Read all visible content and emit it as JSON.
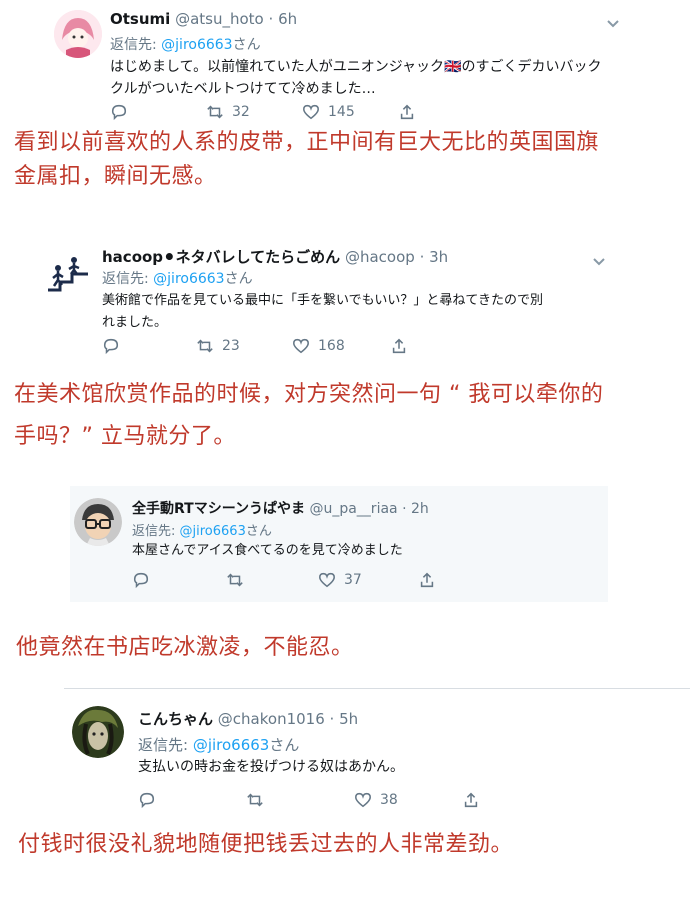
{
  "colors": {
    "caption": "#c0392b",
    "mention": "#1da1f2",
    "meta": "#657786",
    "name": "#14171a",
    "card_bg": "#f5f8fa"
  },
  "tweets": [
    {
      "name": "Otsumi",
      "handle": "@atsu_hoto",
      "dot": "·",
      "time": "6h",
      "reply_prefix": "返信先: ",
      "reply_to": "@jiro6663",
      "reply_suffix": "さん",
      "text_line1": "はじめまして。以前憧れていた人がユニオンジャック",
      "flag": "🇬🇧",
      "text_line1b": "のすごくデカいバック",
      "text_line2": "クルがついたベルトつけてて冷めました…",
      "retweets": "32",
      "likes": "145"
    },
    {
      "name": "hacoop",
      "name_icon": "⚫",
      "name_suffix": "ネタバレしてたらごめん",
      "handle": "@hacoop",
      "dot": "·",
      "time": "3h",
      "reply_prefix": "返信先: ",
      "reply_to": "@jiro6663",
      "reply_suffix": "さん",
      "text_line1": "美術館で作品を見ている最中に「手を繋いでもいい？」と尋ねてきたので別",
      "text_line2": "れました。",
      "retweets": "23",
      "likes": "168"
    },
    {
      "name": "全手動RTマシーンうぱやま",
      "handle": "@u_pa__riaa",
      "dot": "·",
      "time": "2h",
      "reply_prefix": "返信先: ",
      "reply_to": "@jiro6663",
      "reply_suffix": "さん",
      "text_line1": "本屋さんでアイス食べてるのを見て冷めました",
      "likes": "37"
    },
    {
      "name": "こんちゃん",
      "handle": "@chakon1016",
      "dot": "·",
      "time": "5h",
      "reply_prefix": "返信先: ",
      "reply_to": "@jiro6663",
      "reply_suffix": "さん",
      "text_line1": "支払いの時お金を投げつける奴はあかん。",
      "likes": "38"
    }
  ],
  "captions": [
    {
      "line1": "看到以前喜欢的人系的皮带，正中间有巨大无比的英国国旗",
      "line2": "金属扣，瞬间无感。"
    },
    {
      "line1": "在美术馆欣赏作品的时候，对方突然问一句 “ 我可以牵你的",
      "line2": "手吗？” 立马就分了。"
    },
    {
      "line1": "他竟然在书店吃冰激凌，不能忍。"
    },
    {
      "line1": "付钱时很没礼貌地随便把钱丢过去的人非常差劲。"
    }
  ]
}
